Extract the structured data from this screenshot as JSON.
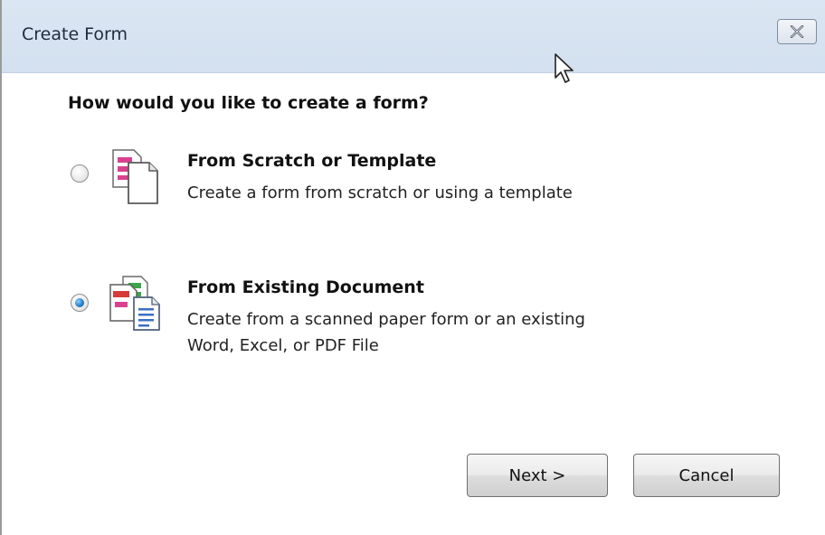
{
  "dialog": {
    "title": "Create Form",
    "close_icon": "close-x-icon"
  },
  "question": "How would you like to create a form?",
  "options": [
    {
      "title": "From Scratch or Template",
      "description_lines": [
        "Create a form from scratch or using a template"
      ],
      "selected": false,
      "icon": "blank-form-icon"
    },
    {
      "title": "From Existing Document",
      "description_lines": [
        "Create from a scanned paper form or an existing",
        "Word, Excel, or PDF File"
      ],
      "selected": true,
      "icon": "existing-document-icon"
    }
  ],
  "buttons": {
    "next": "Next >",
    "cancel": "Cancel"
  },
  "colors": {
    "titlebar": "#d3e0ef",
    "radio_selected": "#2a7fc8",
    "form_field_pink": "#d9418f",
    "form_field_red": "#d63a3a",
    "form_field_green": "#3aa64a",
    "text_lines_blue": "#3b6fc4"
  }
}
